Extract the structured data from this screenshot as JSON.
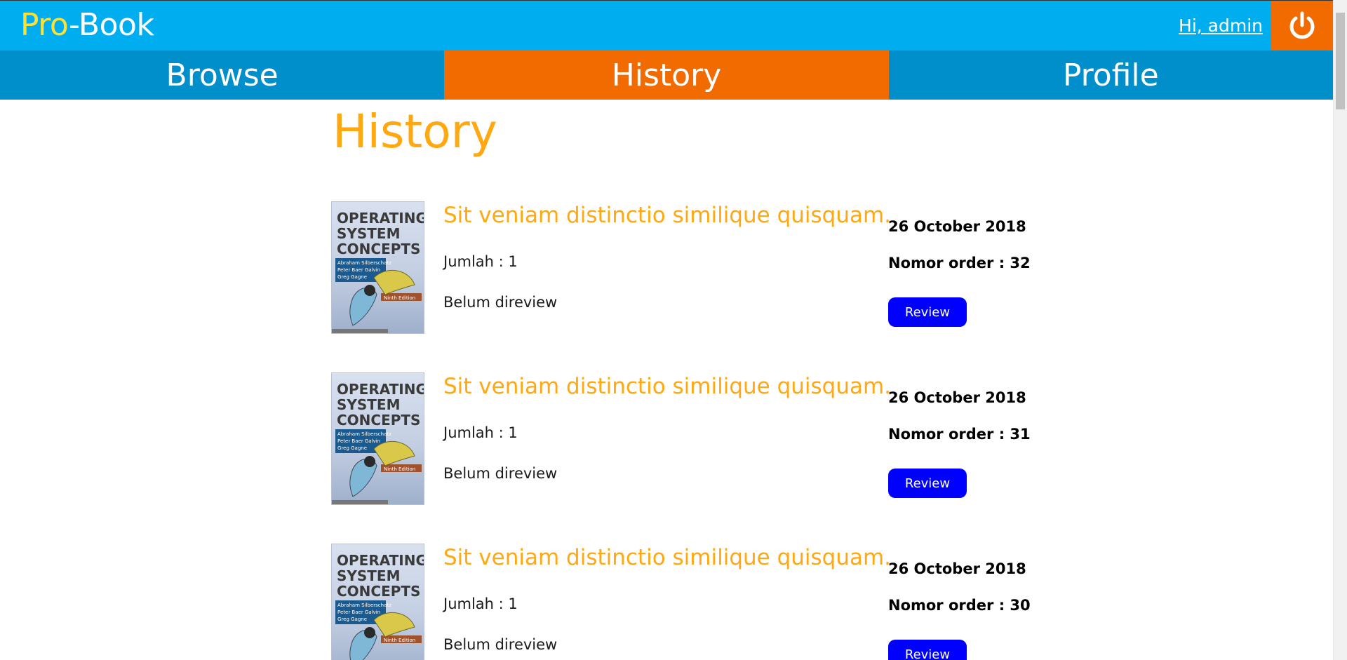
{
  "header": {
    "logo_pro": "Pro",
    "logo_rest": "-Book",
    "greeting": "Hi, admin",
    "logout_icon": "power-icon"
  },
  "nav": {
    "tabs": [
      {
        "label": "Browse",
        "active": false
      },
      {
        "label": "History",
        "active": true
      },
      {
        "label": "Profile",
        "active": false
      }
    ]
  },
  "page": {
    "title": "History"
  },
  "cover": {
    "line1": "OPERATING",
    "line2": "SYSTEM",
    "line3": "CONCEPTS",
    "authors": [
      "Abraham Silberschatz",
      "Peter Baer Galvin",
      "Greg Gagne"
    ],
    "edition": "Ninth Edition"
  },
  "orders": [
    {
      "title": "Sit veniam distinctio similique quisquam.",
      "qty": "Jumlah : 1",
      "review_status": "Belum direview",
      "date": "26 October 2018",
      "order": "Nomor order : 32",
      "button": "Review"
    },
    {
      "title": "Sit veniam distinctio similique quisquam.",
      "qty": "Jumlah : 1",
      "review_status": "Belum direview",
      "date": "26 October 2018",
      "order": "Nomor order : 31",
      "button": "Review"
    },
    {
      "title": "Sit veniam distinctio similique quisquam.",
      "qty": "Jumlah : 1",
      "review_status": "Belum direview",
      "date": "26 October 2018",
      "order": "Nomor order : 30",
      "button": "Review"
    }
  ],
  "colors": {
    "header": "#00aeef",
    "nav": "#008fca",
    "active": "#f26b00",
    "title": "#ffa812",
    "button": "#0000ff"
  }
}
